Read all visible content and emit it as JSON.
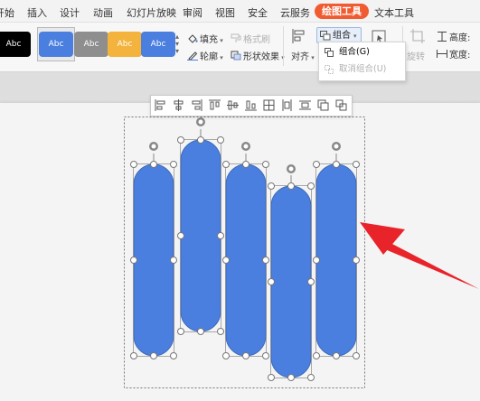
{
  "menu_tabs": [
    "开始",
    "插入",
    "设计",
    "动画",
    "幻灯片放映",
    "审阅",
    "视图",
    "安全",
    "云服务",
    "绘图工具",
    "文本工具"
  ],
  "active_tab": "绘图工具",
  "ribbon": {
    "style_swatches": [
      {
        "label": "Abc",
        "fill": "#000000",
        "text_color": "#ffffff"
      },
      {
        "label": "Abc",
        "fill": "#4a7fe0",
        "text_color": "#ffffff"
      },
      {
        "label": "Abc",
        "fill": "#8e8e8e",
        "text_color": "#ffffff"
      },
      {
        "label": "Abc",
        "fill": "#f3b33c",
        "text_color": "#ffffff"
      },
      {
        "label": "Abc",
        "fill": "#4a7fe0",
        "text_color": "#ffffff"
      }
    ],
    "fill_label": "填充",
    "format_painter_label": "格式刷",
    "outline_label": "轮廓",
    "shape_effects_label": "形状效果",
    "align_label": "对齐",
    "group_label": "组合",
    "rotate_label": "旋转",
    "height_label": "高度:",
    "width_label": "宽度:"
  },
  "group_menu": {
    "items": [
      {
        "label": "组合(G)",
        "enabled": true
      },
      {
        "label": "取消组合(U)",
        "enabled": false
      }
    ]
  },
  "colors": {
    "accent": "#f05b31",
    "shape_fill": "#4a7fe0",
    "arrow": "#e8232a"
  }
}
